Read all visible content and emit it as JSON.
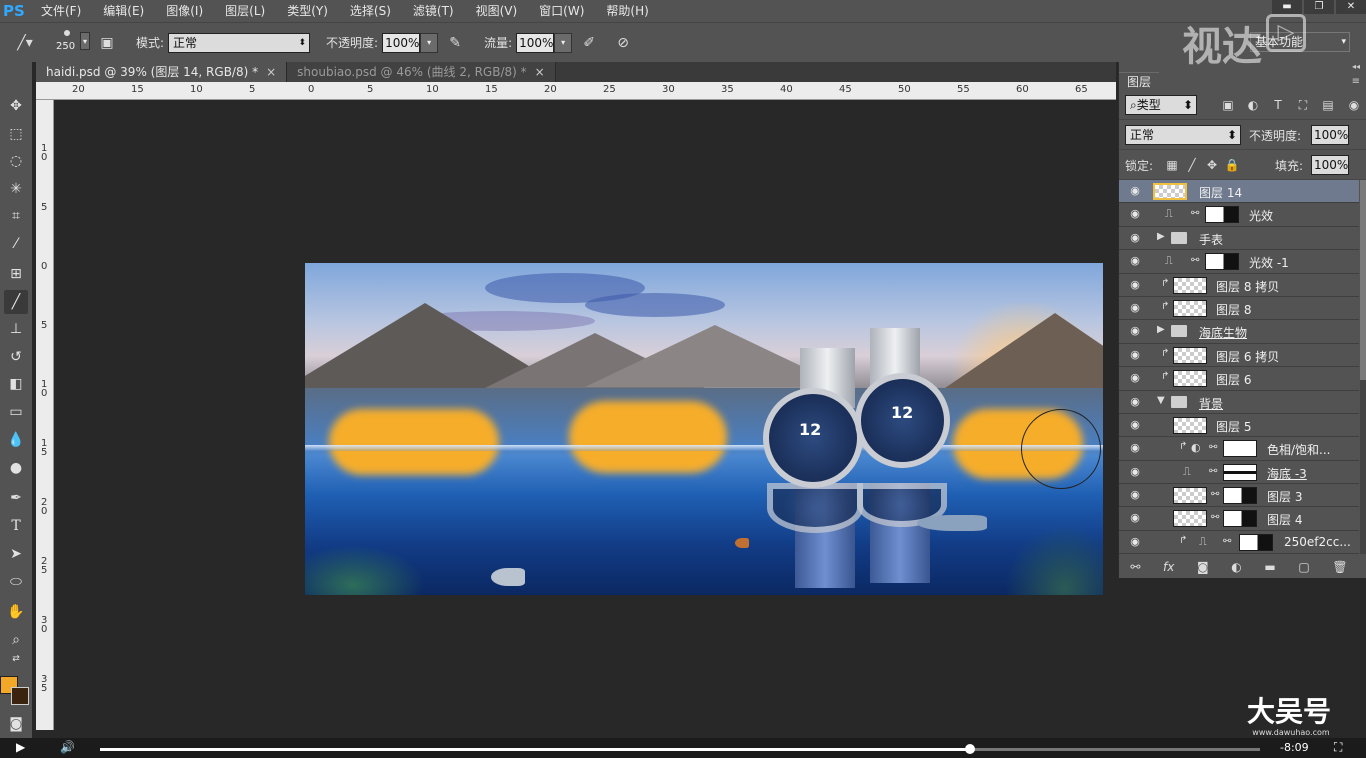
{
  "app_logo": "PS",
  "menu": [
    "文件(F)",
    "编辑(E)",
    "图像(I)",
    "图层(L)",
    "类型(Y)",
    "选择(S)",
    "滤镜(T)",
    "视图(V)",
    "窗口(W)",
    "帮助(H)"
  ],
  "options": {
    "brush_size": "250",
    "mode_label": "模式:",
    "mode_value": "正常",
    "opacity_label": "不透明度:",
    "opacity_value": "100%",
    "flow_label": "流量:",
    "flow_value": "100%",
    "workspace": "基本功能"
  },
  "tabs": [
    {
      "label": "haidi.psd @ 39% (图层 14, RGB/8) *",
      "active": true
    },
    {
      "label": "shoubiao.psd @ 46% (曲线 2, RGB/8) *",
      "active": false
    }
  ],
  "ruler_h": [
    "20",
    "15",
    "10",
    "5",
    "0",
    "5",
    "10",
    "15",
    "20",
    "25",
    "30",
    "35",
    "40",
    "45",
    "50",
    "55",
    "60",
    "65"
  ],
  "ruler_v": [
    "1\n0",
    "5",
    "0",
    "5",
    "1\n0",
    "1\n5",
    "2\n0",
    "2\n5",
    "3\n0",
    "3\n5"
  ],
  "colors": {
    "foreground": "#f4a828",
    "background": "#3a2410",
    "selection": "#6f7a8e"
  },
  "layers_panel": {
    "tab": "图层",
    "filter_kind": "类型",
    "blend_mode": "正常",
    "opacity_label": "不透明度:",
    "opacity_value": "100%",
    "lock_label": "锁定:",
    "fill_label": "填充:",
    "fill_value": "100%",
    "layers": [
      {
        "name": "图层 14",
        "type": "pixel",
        "selected": true
      },
      {
        "name": "光效",
        "type": "adjust-mask"
      },
      {
        "name": "手表",
        "type": "group-collapsed"
      },
      {
        "name": "光效 -1",
        "type": "adjust-mask"
      },
      {
        "name": "图层 8 拷贝",
        "type": "clipped-pixel"
      },
      {
        "name": "图层 8",
        "type": "clipped-pixel"
      },
      {
        "name": "海底生物",
        "type": "group-collapsed",
        "underline": true
      },
      {
        "name": "图层 6 拷贝",
        "type": "clipped-pixel"
      },
      {
        "name": "图层 6",
        "type": "clipped-pixel"
      },
      {
        "name": "背景",
        "type": "group-open",
        "underline": true
      },
      {
        "name": "图层 5",
        "type": "pixel-indented"
      },
      {
        "name": "色相/饱和...",
        "type": "hue-sat"
      },
      {
        "name": "海底 -3",
        "type": "adjust-line",
        "underline": true
      },
      {
        "name": "图层 3",
        "type": "pixel-mask"
      },
      {
        "name": "图层 4",
        "type": "pixel-mask"
      },
      {
        "name": "250ef2cc...",
        "type": "smart-clipped"
      }
    ]
  },
  "watermark_top": "视达",
  "watermark_bottom": "大吴号",
  "watermark_url": "www.dawuhao.com",
  "video": {
    "progress": 0.75,
    "time_left": "-8:09"
  }
}
